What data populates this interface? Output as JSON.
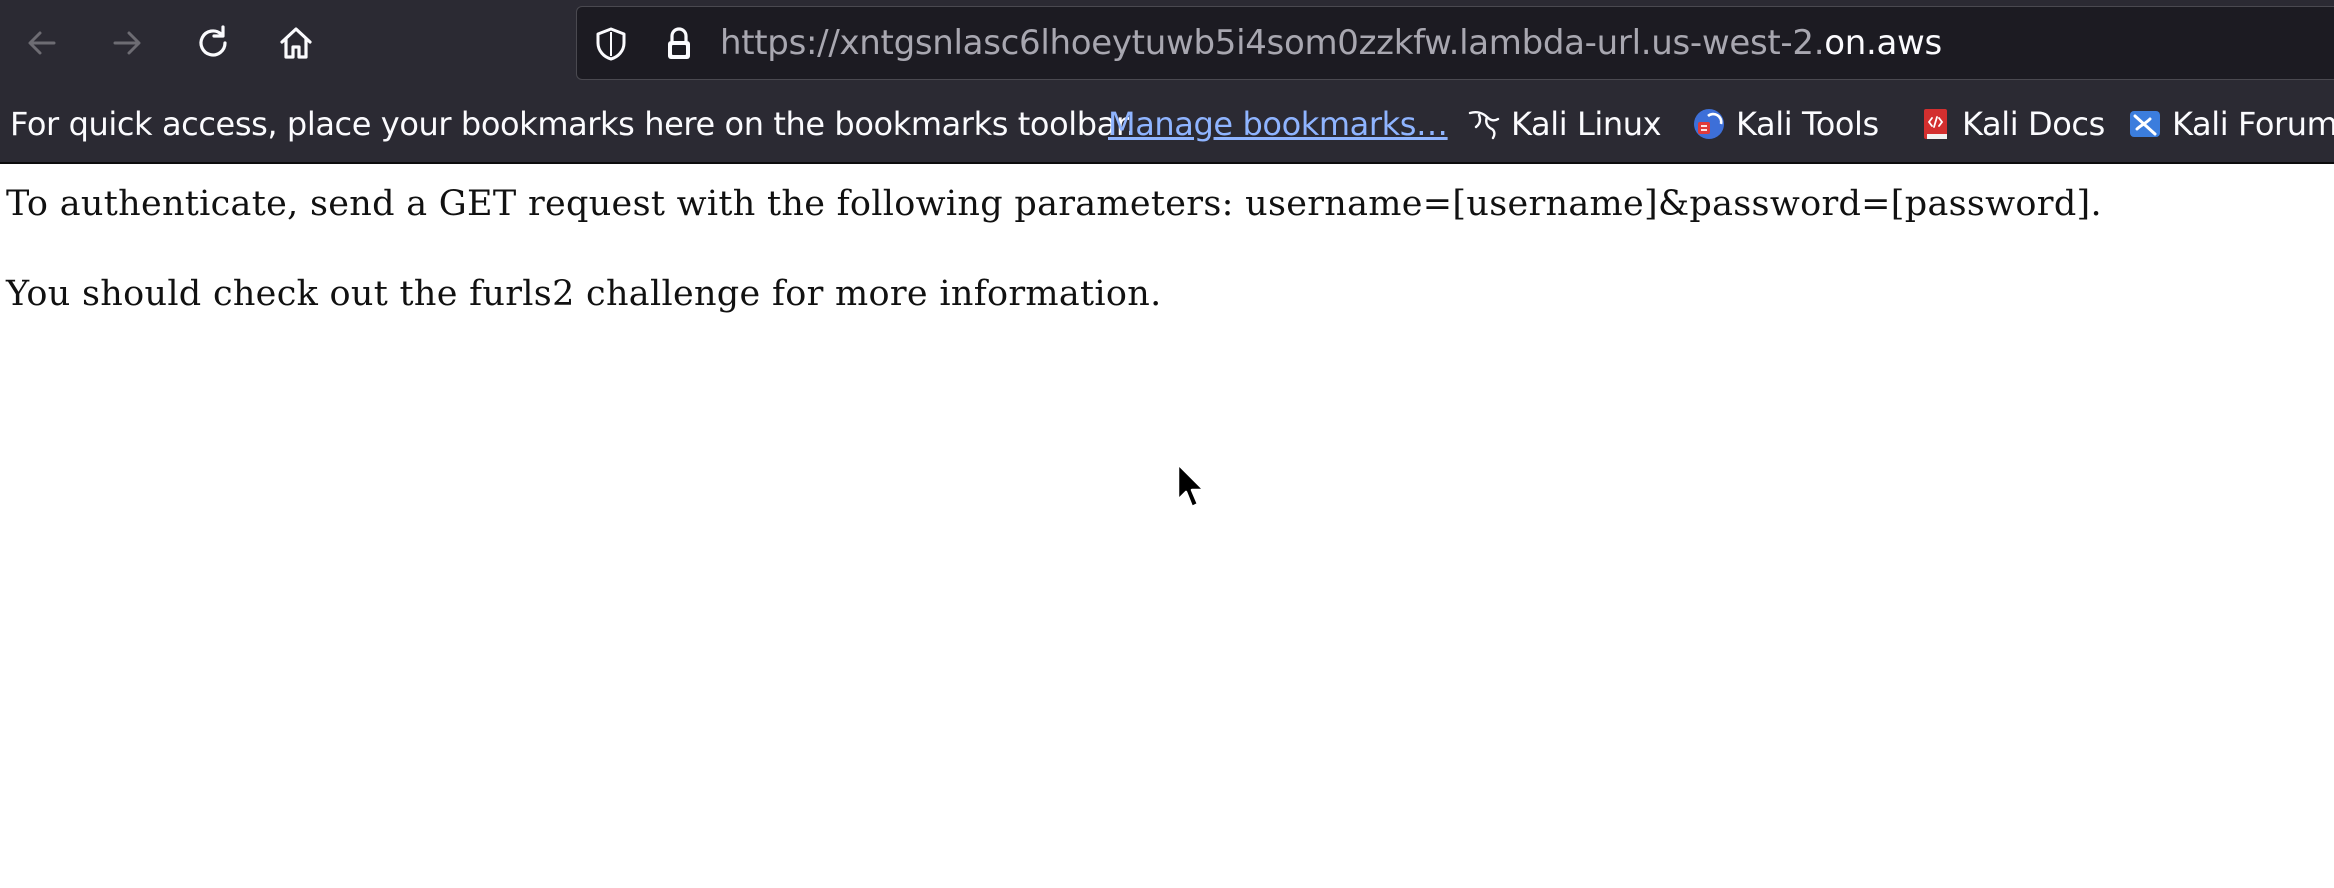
{
  "nav": {
    "back_icon": "arrow-left-icon",
    "forward_icon": "arrow-right-icon",
    "reload_icon": "reload-icon",
    "home_icon": "home-icon"
  },
  "urlbar": {
    "url_prefix": "https://xntgsnlasc6lhoeytuwb5i4som0zzkfw.lambda-url.us-west-2.",
    "url_domain": "on.aws"
  },
  "bookmarks": {
    "hint": "For quick access, place your bookmarks here on the bookmarks toolbar.",
    "manage_label": "Manage bookmarks…",
    "items": [
      {
        "label": "Kali Linux",
        "icon": "kali-dragon-icon"
      },
      {
        "label": "Kali Tools",
        "icon": "kali-tools-icon"
      },
      {
        "label": "Kali Docs",
        "icon": "kali-docs-icon"
      },
      {
        "label": "Kali Forums",
        "icon": "kali-forums-icon"
      }
    ]
  },
  "page": {
    "line1": "To authenticate, send a GET request with the following parameters: username=[username]&password=[password].",
    "line2": "You should check out the furls2 challenge for more information."
  },
  "colors": {
    "toolbar_bg": "#2b2a33",
    "urlbar_bg": "#1c1b22",
    "link": "#8fb4ff"
  }
}
